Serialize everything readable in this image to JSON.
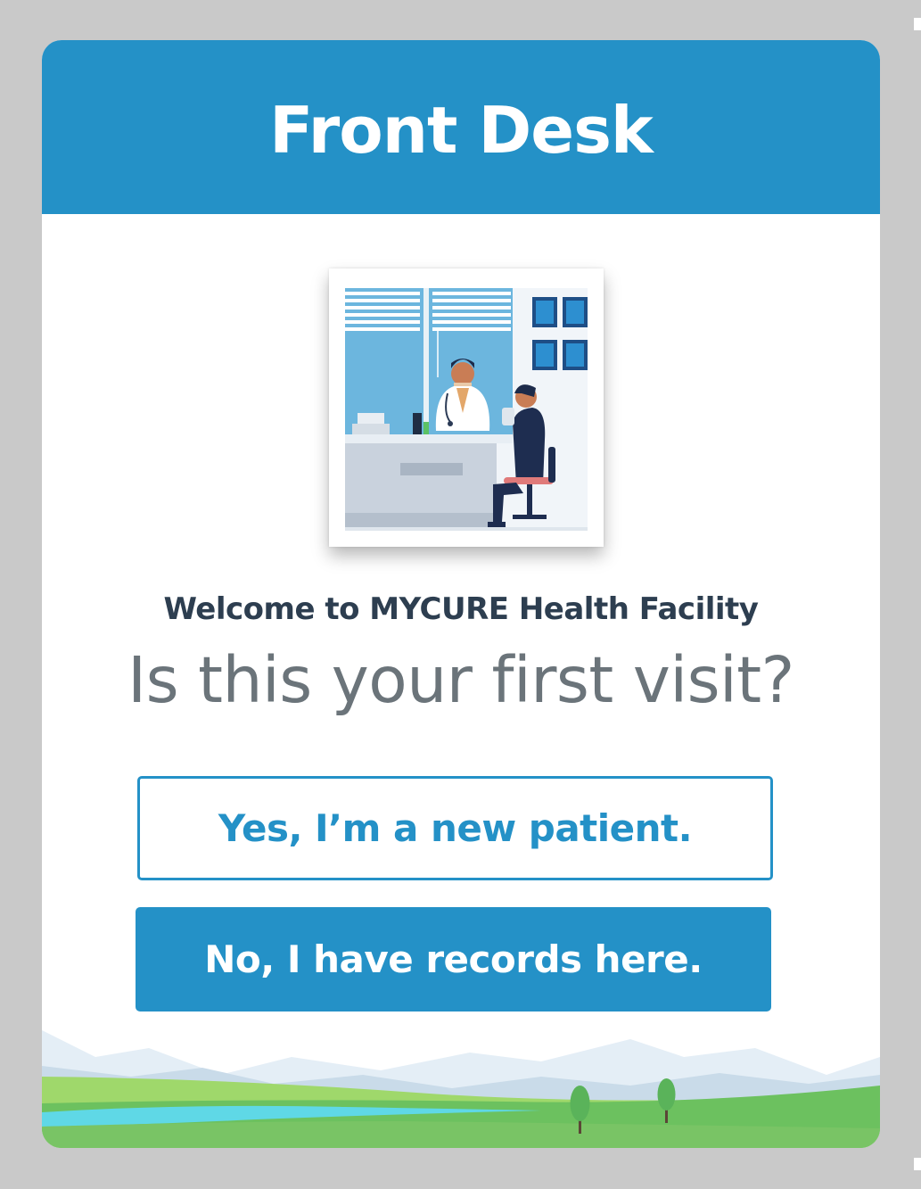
{
  "header": {
    "title": "Front Desk"
  },
  "welcome_text": "Welcome to MYCURE Health Facility",
  "question_text": "Is this your first visit?",
  "buttons": {
    "new_patient_label": "Yes, I’m a new patient.",
    "has_records_label": "No, I have records here."
  },
  "colors": {
    "brand": "#2491c7",
    "welcome_text": "#2d3e50",
    "question_text": "#6b747a",
    "page_background": "#c9c9c9"
  }
}
